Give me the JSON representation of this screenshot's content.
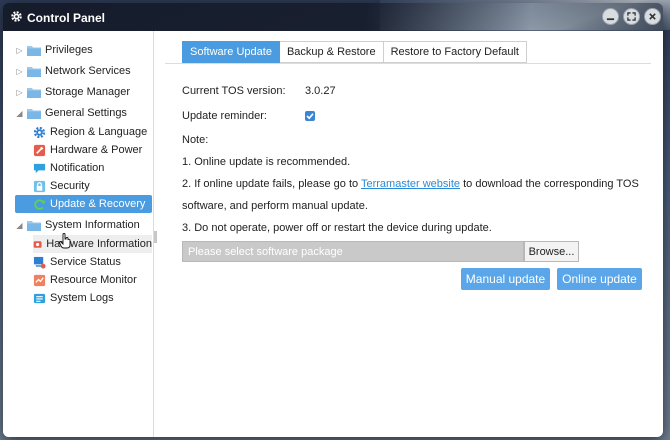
{
  "window": {
    "title": "Control Panel",
    "icons": {
      "app": "gear-icon",
      "minimize": "minimize-icon",
      "maximize": "maximize-icon",
      "close": "close-icon"
    }
  },
  "sidebar": {
    "items": [
      {
        "label": "Privileges",
        "type": "group",
        "expanded": false,
        "icon": "folder-icon"
      },
      {
        "label": "Network Services",
        "type": "group",
        "expanded": false,
        "icon": "folder-icon"
      },
      {
        "label": "Storage Manager",
        "type": "group",
        "expanded": false,
        "icon": "folder-icon"
      },
      {
        "label": "General Settings",
        "type": "group",
        "expanded": true,
        "icon": "folder-icon"
      },
      {
        "label": "Region & Language",
        "type": "leaf",
        "icon": "region-gear-icon"
      },
      {
        "label": "Hardware & Power",
        "type": "leaf",
        "icon": "hardware-wrench-icon"
      },
      {
        "label": "Notification",
        "type": "leaf",
        "icon": "notification-chat-icon"
      },
      {
        "label": "Security",
        "type": "leaf",
        "icon": "security-lock-icon"
      },
      {
        "label": "Update & Recovery",
        "type": "leaf",
        "icon": "update-refresh-icon",
        "selected": true
      },
      {
        "label": "System Information",
        "type": "group",
        "expanded": true,
        "icon": "folder-icon"
      },
      {
        "label": "Hardware Information",
        "type": "leaf",
        "icon": "hardware-info-icon",
        "hovered": true
      },
      {
        "label": "Service Status",
        "type": "leaf",
        "icon": "service-status-icon"
      },
      {
        "label": "Resource Monitor",
        "type": "leaf",
        "icon": "resource-monitor-icon"
      },
      {
        "label": "System Logs",
        "type": "leaf",
        "icon": "system-logs-icon"
      }
    ]
  },
  "tabs": [
    {
      "label": "Software Update",
      "active": true
    },
    {
      "label": "Backup & Restore",
      "active": false
    },
    {
      "label": "Restore to Factory Default",
      "active": false
    }
  ],
  "update": {
    "version_label": "Current TOS version:",
    "version_value": "3.0.27",
    "reminder_label": "Update reminder:",
    "reminder_checked": true,
    "note_label": "Note:",
    "note1": "1. Online update is recommended.",
    "note2_prefix": "2. If online update fails, please go to",
    "note2_link": "Terramaster website",
    "note2_suffix": "to download the corresponding TOS",
    "note2_line2": "software, and perform manual update.",
    "note3": "3. Do not operate, power off or restart the device during update.",
    "file_placeholder": "Please select software package",
    "browse_label": "Browse...",
    "manual_label": "Manual update",
    "online_label": "Online update"
  },
  "colors": {
    "accent": "#4a9be0",
    "button": "#5aa6e8",
    "link": "#2b8ad8"
  }
}
